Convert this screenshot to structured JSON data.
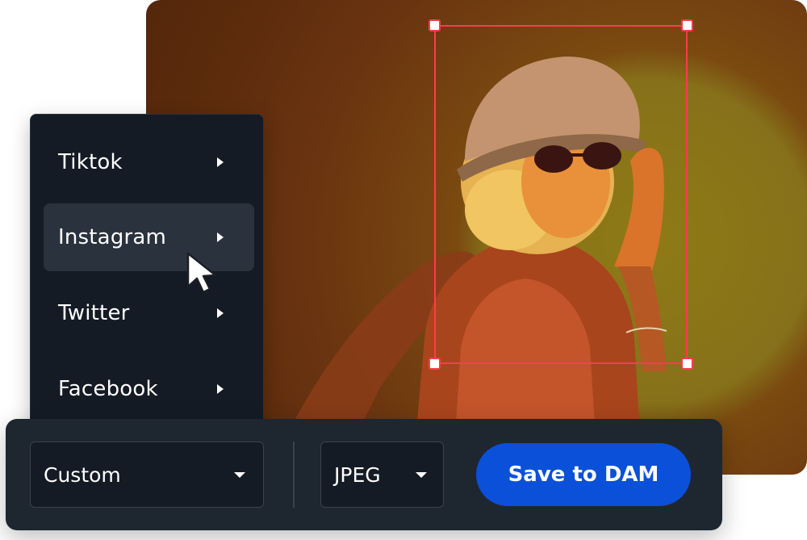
{
  "menu": {
    "items": [
      {
        "label": "Tiktok"
      },
      {
        "label": "Instagram"
      },
      {
        "label": "Twitter"
      },
      {
        "label": "Facebook"
      }
    ],
    "active_item": "Instagram"
  },
  "toolbar": {
    "size_select": {
      "value": "Custom"
    },
    "format_select": {
      "value": "JPEG"
    },
    "save_label": "Save to DAM"
  },
  "photo": {
    "subject": "woman in bucket hat and sunglasses"
  },
  "colors": {
    "crop_border": "#ff3b4f",
    "save_button": "#0b50d8",
    "menu_bg": "#141b24",
    "toolbar_bg": "#1e2630"
  },
  "icons": {
    "submenu": "chevron-right-icon",
    "dropdown": "chevron-down-icon",
    "pointer": "mouse-cursor-icon"
  }
}
